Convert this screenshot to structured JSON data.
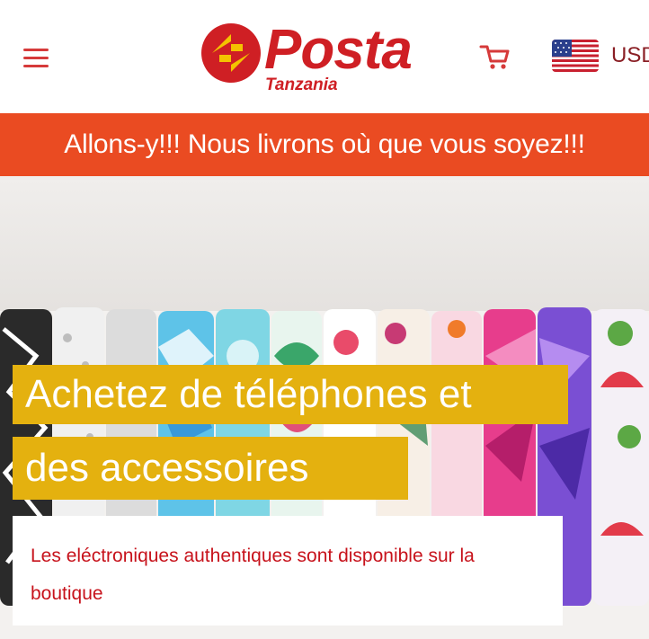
{
  "header": {
    "menu_icon": "hamburger-menu-icon",
    "logo": {
      "word": "Posta",
      "subtitle": "Tanzania",
      "mark_icon": "posta-arrow-logo-icon"
    },
    "cart_icon": "shopping-cart-icon",
    "flag_icon": "us-flag-icon",
    "currency": "USD"
  },
  "announcement": {
    "text": "Allons-y!!! Nous livrons où que vous soyez!!!"
  },
  "hero": {
    "headline_line1": "Achetez de téléphones et",
    "headline_line2": "des accessoires",
    "description": "Les eléctroniques authentiques sont disponible sur la boutique"
  },
  "colors": {
    "brand_red": "#cf1f24",
    "brand_yellow": "#f4c300",
    "announcement_bg": "#ea4b22",
    "headline_bg": "#e4b10f",
    "description_text": "#c7121b"
  }
}
